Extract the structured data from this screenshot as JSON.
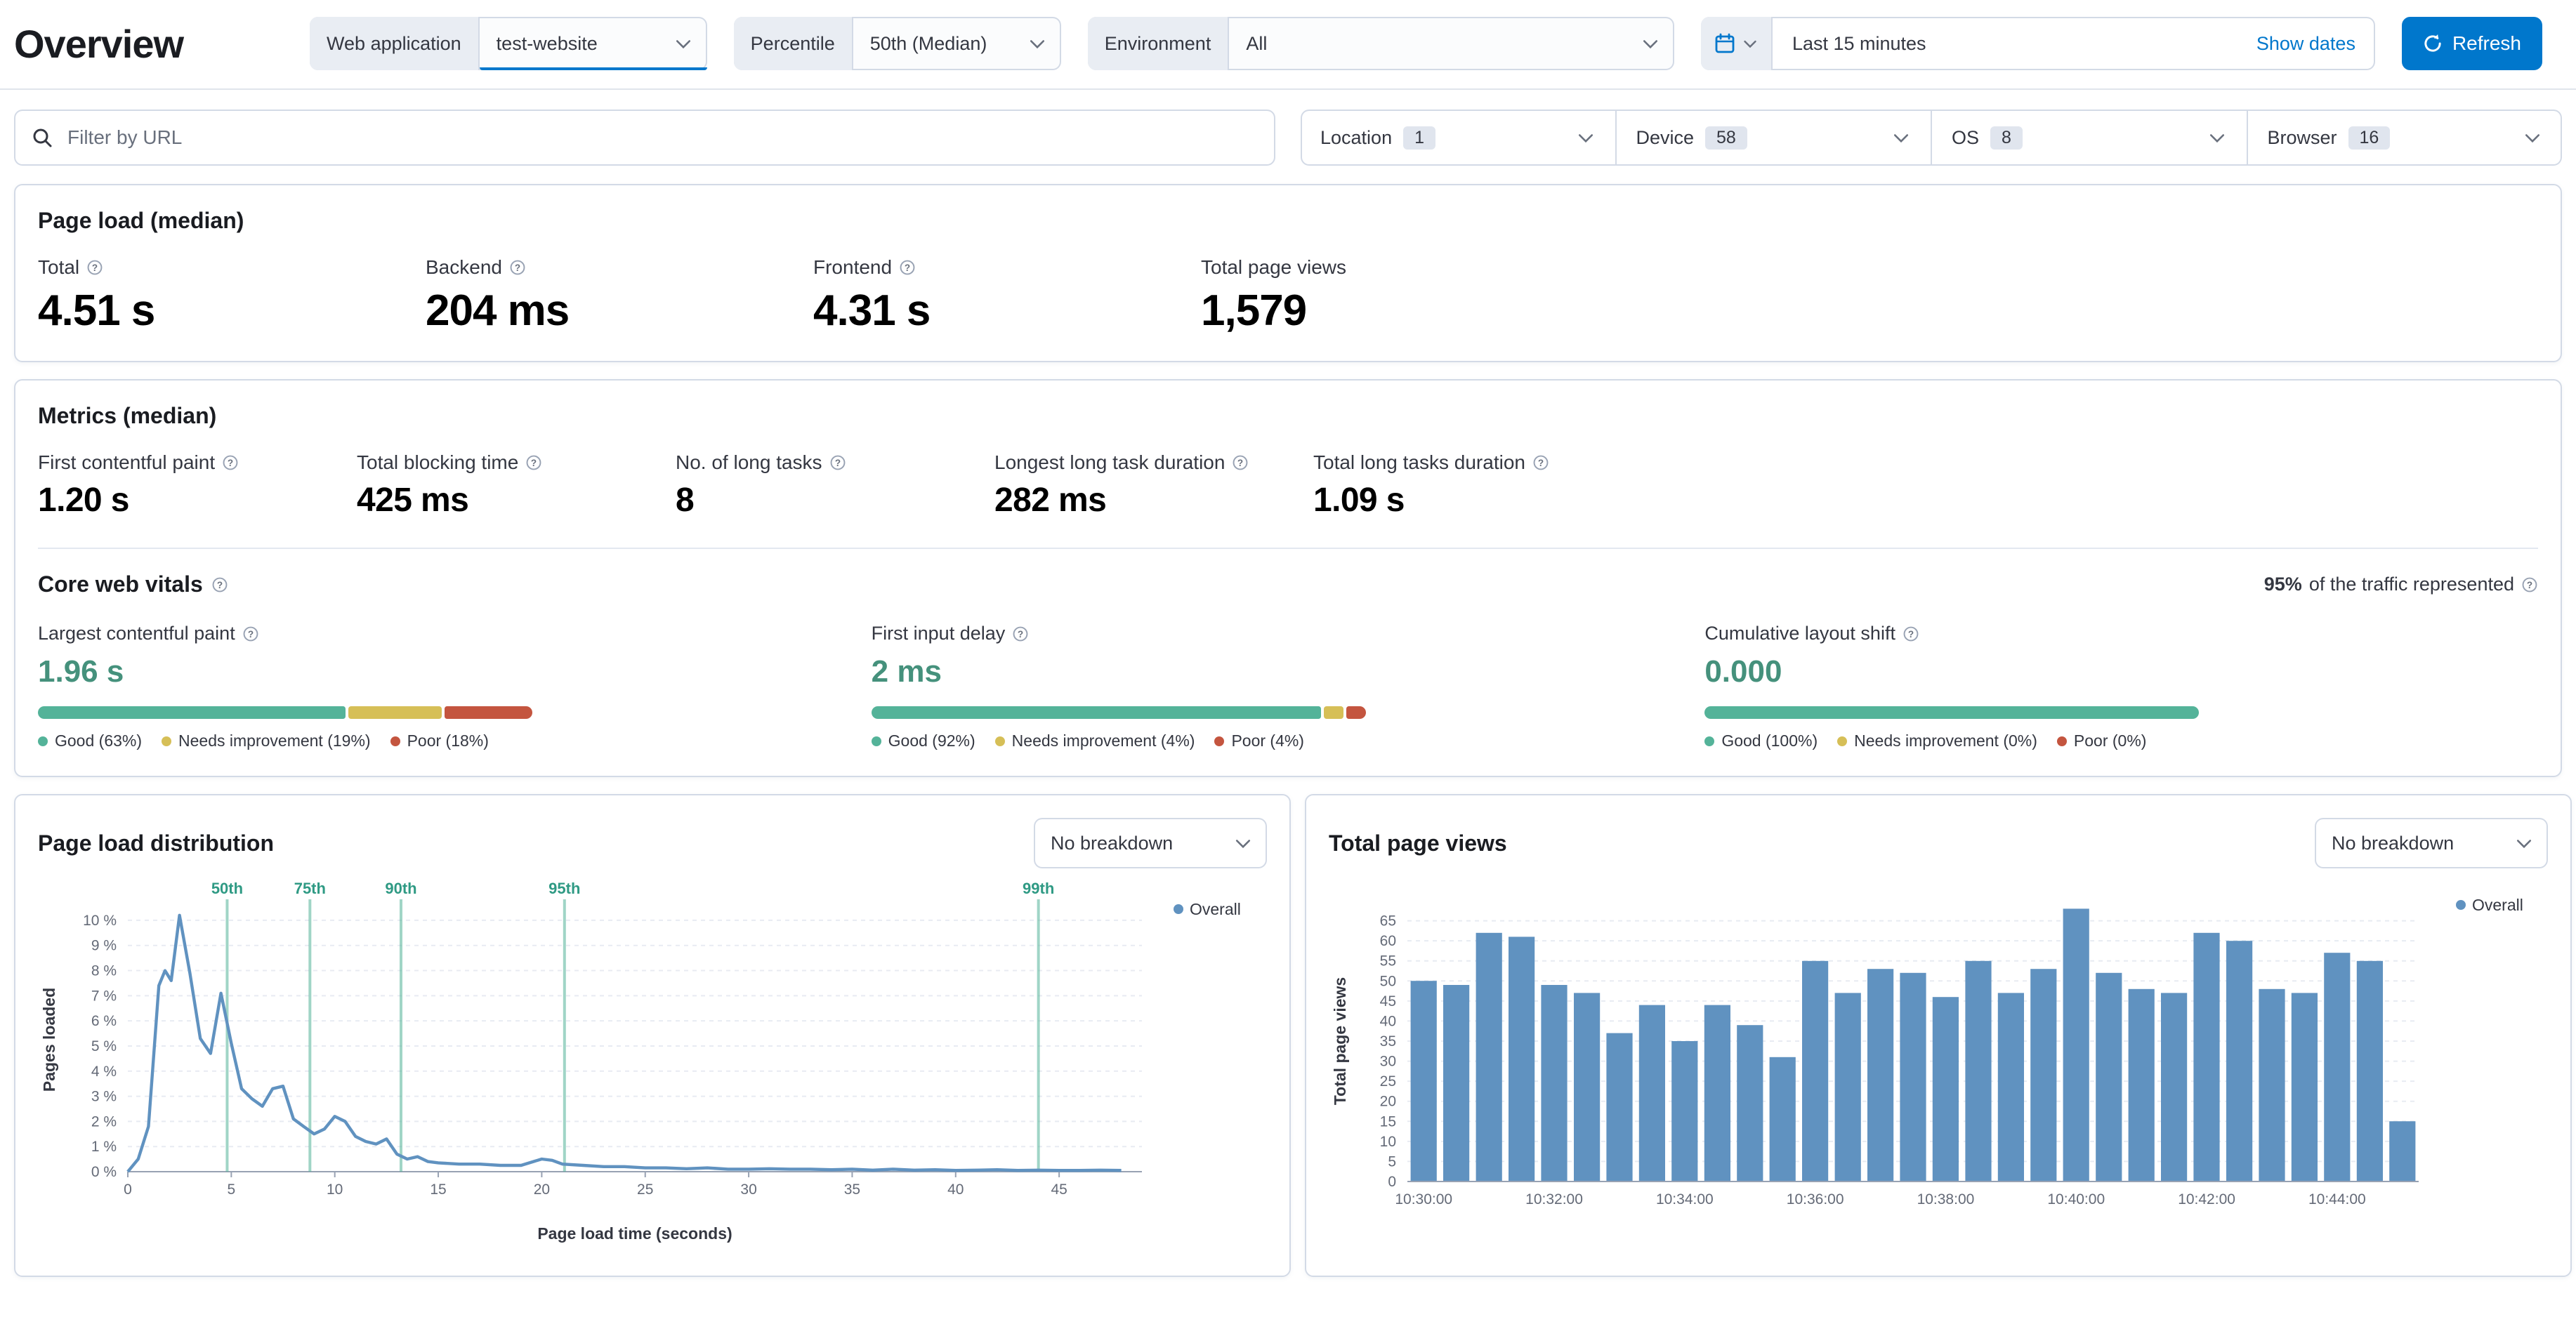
{
  "page": {
    "title": "Overview"
  },
  "toolbar": {
    "web_application": {
      "label": "Web application",
      "value": "test-website"
    },
    "percentile": {
      "label": "Percentile",
      "value": "50th (Median)"
    },
    "environment": {
      "label": "Environment",
      "value": "All"
    },
    "time_range": {
      "value": "Last 15 minutes",
      "show_dates": "Show dates"
    },
    "refresh": "Refresh"
  },
  "filter_bar": {
    "url_placeholder": "Filter by URL",
    "filters": [
      {
        "label": "Location",
        "count": "1"
      },
      {
        "label": "Device",
        "count": "58"
      },
      {
        "label": "OS",
        "count": "8"
      },
      {
        "label": "Browser",
        "count": "16"
      }
    ]
  },
  "page_load": {
    "title": "Page load (median)",
    "stats": [
      {
        "label": "Total",
        "value": "4.51 s"
      },
      {
        "label": "Backend",
        "value": "204 ms"
      },
      {
        "label": "Frontend",
        "value": "4.31 s"
      },
      {
        "label": "Total page views",
        "value": "1,579"
      }
    ]
  },
  "metrics": {
    "title": "Metrics (median)",
    "stats": [
      {
        "label": "First contentful paint",
        "value": "1.20 s"
      },
      {
        "label": "Total blocking time",
        "value": "425 ms"
      },
      {
        "label": "No. of long tasks",
        "value": "8"
      },
      {
        "label": "Longest long task duration",
        "value": "282 ms"
      },
      {
        "label": "Total long tasks duration",
        "value": "1.09 s"
      }
    ]
  },
  "core_web_vitals": {
    "title": "Core web vitals",
    "traffic_percent": "95%",
    "traffic_note": "of the traffic represented",
    "vitals": [
      {
        "label": "Largest contentful paint",
        "value": "1.96 s",
        "good": 63,
        "needs_improvement": 19,
        "poor": 18,
        "legend": [
          "Good (63%)",
          "Needs improvement (19%)",
          "Poor (18%)"
        ]
      },
      {
        "label": "First input delay",
        "value": "2 ms",
        "good": 92,
        "needs_improvement": 4,
        "poor": 4,
        "legend": [
          "Good (92%)",
          "Needs improvement (4%)",
          "Poor (4%)"
        ]
      },
      {
        "label": "Cumulative layout shift",
        "value": "0.000",
        "good": 100,
        "needs_improvement": 0,
        "poor": 0,
        "legend": [
          "Good (100%)",
          "Needs improvement (0%)",
          "Poor (0%)"
        ]
      }
    ]
  },
  "panels": {
    "page_load_distribution": {
      "title": "Page load distribution",
      "breakdown": "No breakdown"
    },
    "total_page_views": {
      "title": "Total page views",
      "breakdown": "No breakdown"
    }
  },
  "colors": {
    "primary": "#0077CC",
    "vis_blue": "#6092C0",
    "good": "#54B399",
    "needs_improvement": "#D6BF57",
    "poor": "#C4553F",
    "vital_value": "#45917C",
    "percentile_line": "#54B399"
  },
  "chart_data": [
    {
      "type": "line",
      "title": "Page load distribution",
      "xlabel": "Page load time (seconds)",
      "ylabel": "Pages loaded",
      "legend": [
        "Overall"
      ],
      "legend_position": "right",
      "grid": true,
      "xlim": [
        0,
        49
      ],
      "ylim": [
        0,
        10.5
      ],
      "x_ticks": [
        0,
        5,
        10,
        15,
        20,
        25,
        30,
        35,
        40,
        45
      ],
      "y_ticks": [
        "0 %",
        "1 %",
        "2 %",
        "3 %",
        "4 %",
        "5 %",
        "6 %",
        "7 %",
        "8 %",
        "9 %",
        "10 %"
      ],
      "percentile_markers": [
        {
          "label": "50th",
          "x": 4.8
        },
        {
          "label": "75th",
          "x": 8.8
        },
        {
          "label": "90th",
          "x": 13.2
        },
        {
          "label": "95th",
          "x": 21.1
        },
        {
          "label": "99th",
          "x": 44.0
        }
      ],
      "series": [
        {
          "name": "Overall",
          "points": [
            [
              0,
              0
            ],
            [
              0.5,
              0.5
            ],
            [
              1,
              1.8
            ],
            [
              1.5,
              7.4
            ],
            [
              1.8,
              8.0
            ],
            [
              2.1,
              7.6
            ],
            [
              2.5,
              10.2
            ],
            [
              3,
              7.9
            ],
            [
              3.5,
              5.3
            ],
            [
              4,
              4.7
            ],
            [
              4.5,
              7.1
            ],
            [
              5,
              5.1
            ],
            [
              5.5,
              3.3
            ],
            [
              6,
              2.9
            ],
            [
              6.5,
              2.6
            ],
            [
              7,
              3.3
            ],
            [
              7.5,
              3.4
            ],
            [
              8,
              2.1
            ],
            [
              8.5,
              1.8
            ],
            [
              9,
              1.5
            ],
            [
              9.5,
              1.7
            ],
            [
              10,
              2.2
            ],
            [
              10.5,
              2.0
            ],
            [
              11,
              1.4
            ],
            [
              11.5,
              1.2
            ],
            [
              12,
              1.1
            ],
            [
              12.5,
              1.3
            ],
            [
              13,
              0.7
            ],
            [
              13.5,
              0.5
            ],
            [
              14,
              0.6
            ],
            [
              14.5,
              0.4
            ],
            [
              15,
              0.35
            ],
            [
              16,
              0.3
            ],
            [
              17,
              0.3
            ],
            [
              18,
              0.25
            ],
            [
              19,
              0.25
            ],
            [
              20,
              0.5
            ],
            [
              20.5,
              0.45
            ],
            [
              21,
              0.3
            ],
            [
              22,
              0.25
            ],
            [
              23,
              0.2
            ],
            [
              24,
              0.2
            ],
            [
              25,
              0.15
            ],
            [
              26,
              0.15
            ],
            [
              27,
              0.12
            ],
            [
              28,
              0.15
            ],
            [
              29,
              0.1
            ],
            [
              30,
              0.1
            ],
            [
              31,
              0.12
            ],
            [
              32,
              0.1
            ],
            [
              33,
              0.1
            ],
            [
              34,
              0.08
            ],
            [
              35,
              0.1
            ],
            [
              36,
              0.06
            ],
            [
              37,
              0.1
            ],
            [
              38,
              0.06
            ],
            [
              39,
              0.08
            ],
            [
              40,
              0.05
            ],
            [
              41,
              0.06
            ],
            [
              42,
              0.08
            ],
            [
              43,
              0.05
            ],
            [
              44,
              0.06
            ],
            [
              45,
              0.05
            ],
            [
              46,
              0.05
            ],
            [
              47,
              0.06
            ],
            [
              48,
              0.05
            ]
          ]
        }
      ]
    },
    {
      "type": "bar",
      "title": "Total page views",
      "xlabel": "",
      "ylabel": "Total page views",
      "legend": [
        "Overall"
      ],
      "grid": true,
      "ylim": [
        0,
        70
      ],
      "y_ticks": [
        0,
        5,
        10,
        15,
        20,
        25,
        30,
        35,
        40,
        45,
        50,
        55,
        60,
        65
      ],
      "x_tick_labels": [
        "10:30:00",
        "10:32:00",
        "10:34:00",
        "10:36:00",
        "10:38:00",
        "10:40:00",
        "10:42:00",
        "10:44:00"
      ],
      "x_tick_every": 4,
      "bucket_seconds": 30,
      "values": [
        50,
        49,
        62,
        61,
        49,
        47,
        37,
        44,
        35,
        44,
        39,
        31,
        55,
        47,
        53,
        52,
        46,
        55,
        47,
        53,
        68,
        52,
        48,
        47,
        62,
        60,
        48,
        47,
        57,
        55,
        15
      ]
    }
  ]
}
